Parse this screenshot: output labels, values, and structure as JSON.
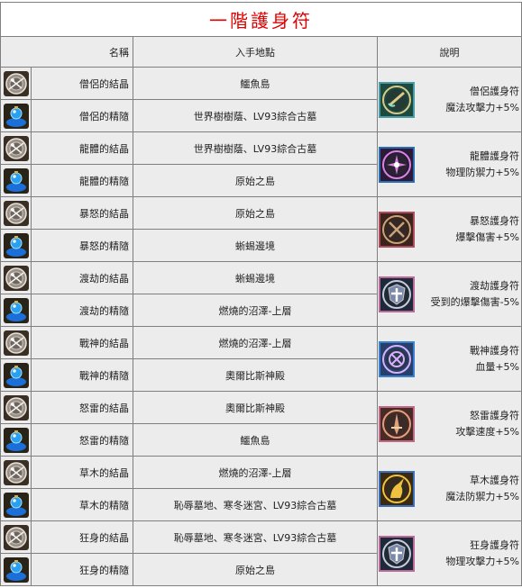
{
  "title": "一階護身符",
  "headers": {
    "name": "名稱",
    "source": "入手地點",
    "description": "說明"
  },
  "rows": [
    {
      "name": "僧侶的結晶",
      "source": "鱷魚島",
      "type": "crystal"
    },
    {
      "name": "僧侶的精隨",
      "source": "世界樹樹蔭、LV93綜合古墓",
      "type": "essence"
    },
    {
      "name": "龍體的結晶",
      "source": "世界樹樹蔭、LV93綜合古墓",
      "type": "crystal"
    },
    {
      "name": "龍體的精隨",
      "source": "原始之島",
      "type": "essence"
    },
    {
      "name": "暴怒的結晶",
      "source": "原始之島",
      "type": "crystal"
    },
    {
      "name": "暴怒的精隨",
      "source": "蜥蜴邊境",
      "type": "essence"
    },
    {
      "name": "渡劫的結晶",
      "source": "蜥蜴邊境",
      "type": "crystal"
    },
    {
      "name": "渡劫的精隨",
      "source": "燃燒的沼澤-上層",
      "type": "essence"
    },
    {
      "name": "戰神的結晶",
      "source": "燃燒的沼澤-上層",
      "type": "crystal"
    },
    {
      "name": "戰神的精隨",
      "source": "奧爾比斯神殿",
      "type": "essence"
    },
    {
      "name": "怒雷的結晶",
      "source": "奧爾比斯神殿",
      "type": "crystal"
    },
    {
      "name": "怒雷的精隨",
      "source": "鱷魚島",
      "type": "essence"
    },
    {
      "name": "草木的結晶",
      "source": "燃燒的沼澤-上層",
      "type": "crystal"
    },
    {
      "name": "草木的精隨",
      "source": "恥辱墓地、寒冬迷宮、LV93綜合古墓",
      "type": "essence"
    },
    {
      "name": "狂身的結晶",
      "source": "恥辱墓地、寒冬迷宮、LV93綜合古墓",
      "type": "crystal"
    },
    {
      "name": "狂身的精隨",
      "source": "原始之島",
      "type": "essence"
    }
  ],
  "amulets": [
    {
      "name": "僧侶護身符",
      "effect": "魔法攻擊力+5%",
      "icon": "scroll-sword-icon",
      "frame": "#4a9aa8",
      "bg": "#1d4a3e",
      "accent": "#d9c98a"
    },
    {
      "name": "龍體護身符",
      "effect": "物理防禦力+5%",
      "icon": "starburst-icon",
      "frame": "#2c6fb0",
      "bg": "#2b1a3a",
      "accent": "#d985e0"
    },
    {
      "name": "暴怒護身符",
      "effect": "爆擊傷害+5%",
      "icon": "crossed-swords-icon",
      "frame": "#b04a5e",
      "bg": "#3a241c",
      "accent": "#c9a27a"
    },
    {
      "name": "渡劫護身符",
      "effect": "受到的爆擊傷害-5%",
      "icon": "cross-shield-icon",
      "frame": "#b86a98",
      "bg": "#1e2a3a",
      "accent": "#c8ccd8"
    },
    {
      "name": "戰神護身符",
      "effect": "血量+5%",
      "icon": "crosshair-icon",
      "frame": "#3a7fd0",
      "bg": "#27406a",
      "accent": "#d8b0ff"
    },
    {
      "name": "怒雷護身符",
      "effect": "攻擊速度+5%",
      "icon": "dagger-icon",
      "frame": "#c06a8a",
      "bg": "#4a2a24",
      "accent": "#e0a080"
    },
    {
      "name": "草木護身符",
      "effect": "魔法防禦力+5%",
      "icon": "unicorn-icon",
      "frame": "#3a6fc0",
      "bg": "#3a2a10",
      "accent": "#f0c040"
    },
    {
      "name": "狂身護身符",
      "effect": "物理攻擊力+5%",
      "icon": "cross-shield-icon",
      "frame": "#b86a98",
      "bg": "#1e2a3a",
      "accent": "#c8ccd8"
    }
  ]
}
